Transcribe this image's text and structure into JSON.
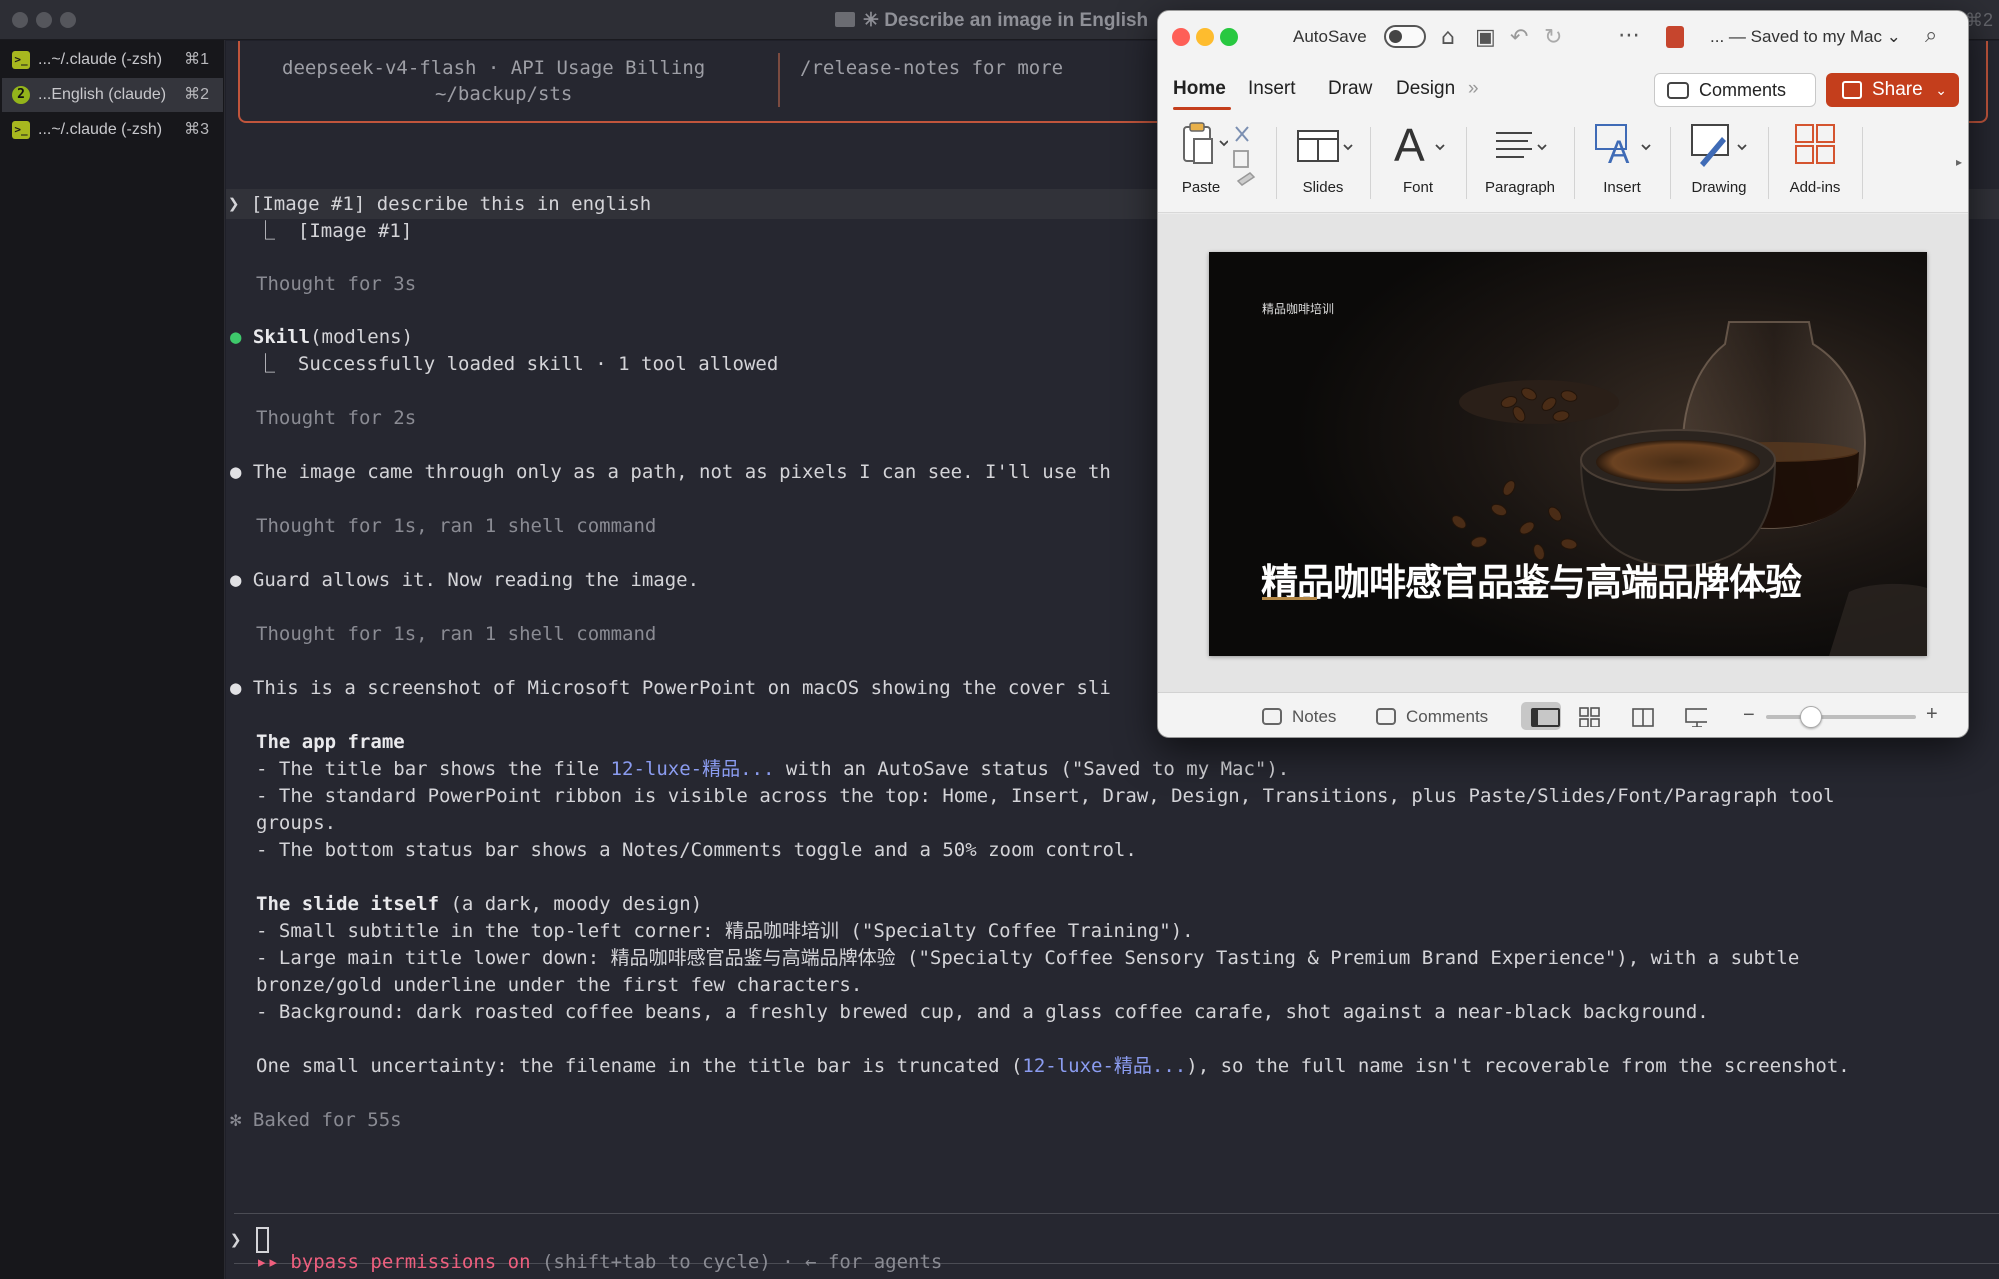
{
  "terminal": {
    "window_title": "✳ Describe an image in English",
    "title_right": "⌘2",
    "tabs": [
      {
        "label": "...~/.claude (-zsh)",
        "shortcut": "⌘1",
        "badge": ">_"
      },
      {
        "label": "...English (claude)",
        "shortcut": "⌘2",
        "badge": "2"
      },
      {
        "label": "...~/.claude (-zsh)",
        "shortcut": "⌘3",
        "badge": ">_"
      }
    ],
    "header": {
      "model_line": "deepseek-v4-flash · API Usage Billing",
      "path_line": "~/backup/sts",
      "notes_line": "/release-notes for more"
    },
    "user_prompt": "❯ [Image #1] describe this in english",
    "user_attachment": "⎿  [Image #1]",
    "thought1": "Thought for 3s",
    "skill_call": {
      "name": "Skill",
      "args": "(modlens)"
    },
    "skill_result": "⎿  Successfully loaded skill · 1 tool allowed",
    "thought2": "Thought for 2s",
    "msg1": "The image came through only as a path, not as pixels I can see. I'll use th",
    "thought3": "Thought for 1s, ran 1 shell command",
    "msg2": "Guard allows it. Now reading the image.",
    "thought4": "Thought for 1s, ran 1 shell command",
    "msg3": "This is a screenshot of Microsoft PowerPoint on macOS showing the cover sli",
    "section1_title": "The app frame",
    "s1_l1_pre": "- The title bar shows the file ",
    "s1_l1_link": "12-luxe-精品...",
    "s1_l1_post": " with an AutoSave status (\"Saved to my Mac\").",
    "s1_l2": "- The standard PowerPoint ribbon is visible across the top: Home, Insert, Draw, Design, Transitions, plus Paste/Slides/Font/Paragraph tool",
    "s1_l2b": "groups.",
    "s1_l3": "- The bottom status bar shows a Notes/Comments toggle and a 50% zoom control.",
    "section2_title": "The slide itself",
    "section2_suffix": " (a dark, moody design)",
    "s2_l1": "- Small subtitle in the top-left corner: 精品咖啡培训 (\"Specialty Coffee Training\").",
    "s2_l2": "- Large main title lower down: 精品咖啡感官品鉴与高端品牌体验 (\"Specialty Coffee Sensory Tasting & Premium Brand Experience\"), with a subtle",
    "s2_l2b": "bronze/gold underline under the first few characters.",
    "s2_l3": "- Background: dark roasted coffee beans, a freshly brewed cup, and a glass coffee carafe, shot against a near-black background.",
    "final_pre": "One small uncertainty: the filename in the title bar is truncated (",
    "final_link": "12-luxe-精品...",
    "final_post": "), so the full name isn't recoverable from the screenshot.",
    "baked": "✻ Baked for 55s",
    "input_prompt": "❯",
    "footer_pink": "▸▸ bypass permissions on",
    "footer_rest": " (shift+tab to cycle) · ← for agents"
  },
  "ppt": {
    "autosave_label": "AutoSave",
    "saved_label": "... — Saved to my Mac ⌄",
    "tabs": [
      "Home",
      "Insert",
      "Draw",
      "Design"
    ],
    "overflow": "»",
    "comments_btn": "Comments",
    "share_btn": "Share",
    "ribbon_groups": [
      "Paste",
      "Slides",
      "Font",
      "Paragraph",
      "Insert",
      "Drawing",
      "Add-ins"
    ],
    "slide": {
      "subtitle": "精品咖啡培训",
      "title": "精品咖啡感官品鉴与高端品牌体验"
    },
    "status": {
      "notes": "Notes",
      "comments": "Comments",
      "zoom_minus": "−",
      "zoom_plus": "+",
      "zoom_level": 0.3
    },
    "colors": {
      "accent": "#c43e1c",
      "underline": "#b58947"
    }
  }
}
